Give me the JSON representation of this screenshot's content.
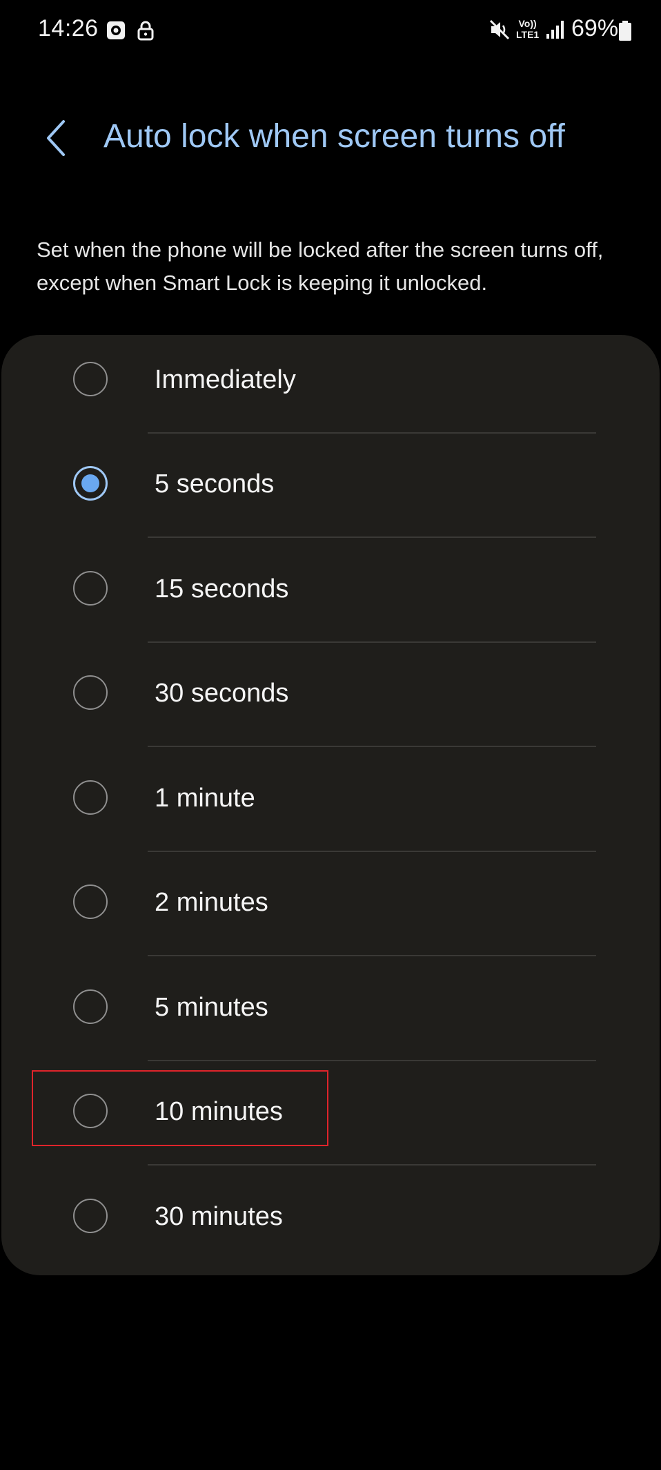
{
  "status_bar": {
    "time": "14:26",
    "volte_top": "Vo))",
    "volte_bottom": "LTE1",
    "battery": "69%",
    "icons": [
      "photo-notification-icon",
      "lock-notification-icon",
      "mute-icon",
      "volte-icon",
      "signal-icon",
      "battery-icon"
    ]
  },
  "header": {
    "title": "Auto lock when screen turns off",
    "back_icon": "chevron-left-icon"
  },
  "description": "Set when the phone will be locked after the screen turns off, except when Smart Lock is keeping it unlocked.",
  "options": [
    {
      "label": "Immediately",
      "selected": false
    },
    {
      "label": "5 seconds",
      "selected": true
    },
    {
      "label": "15 seconds",
      "selected": false
    },
    {
      "label": "30 seconds",
      "selected": false
    },
    {
      "label": "1 minute",
      "selected": false
    },
    {
      "label": "2 minutes",
      "selected": false
    },
    {
      "label": "5 minutes",
      "selected": false
    },
    {
      "label": "10 minutes",
      "selected": false
    },
    {
      "label": "30 minutes",
      "selected": false
    }
  ],
  "colors": {
    "accent": "#9fc8f5",
    "radio_fill": "#6aa8f0",
    "card_background": "#1f1e1b",
    "highlight": "#e0242b"
  }
}
